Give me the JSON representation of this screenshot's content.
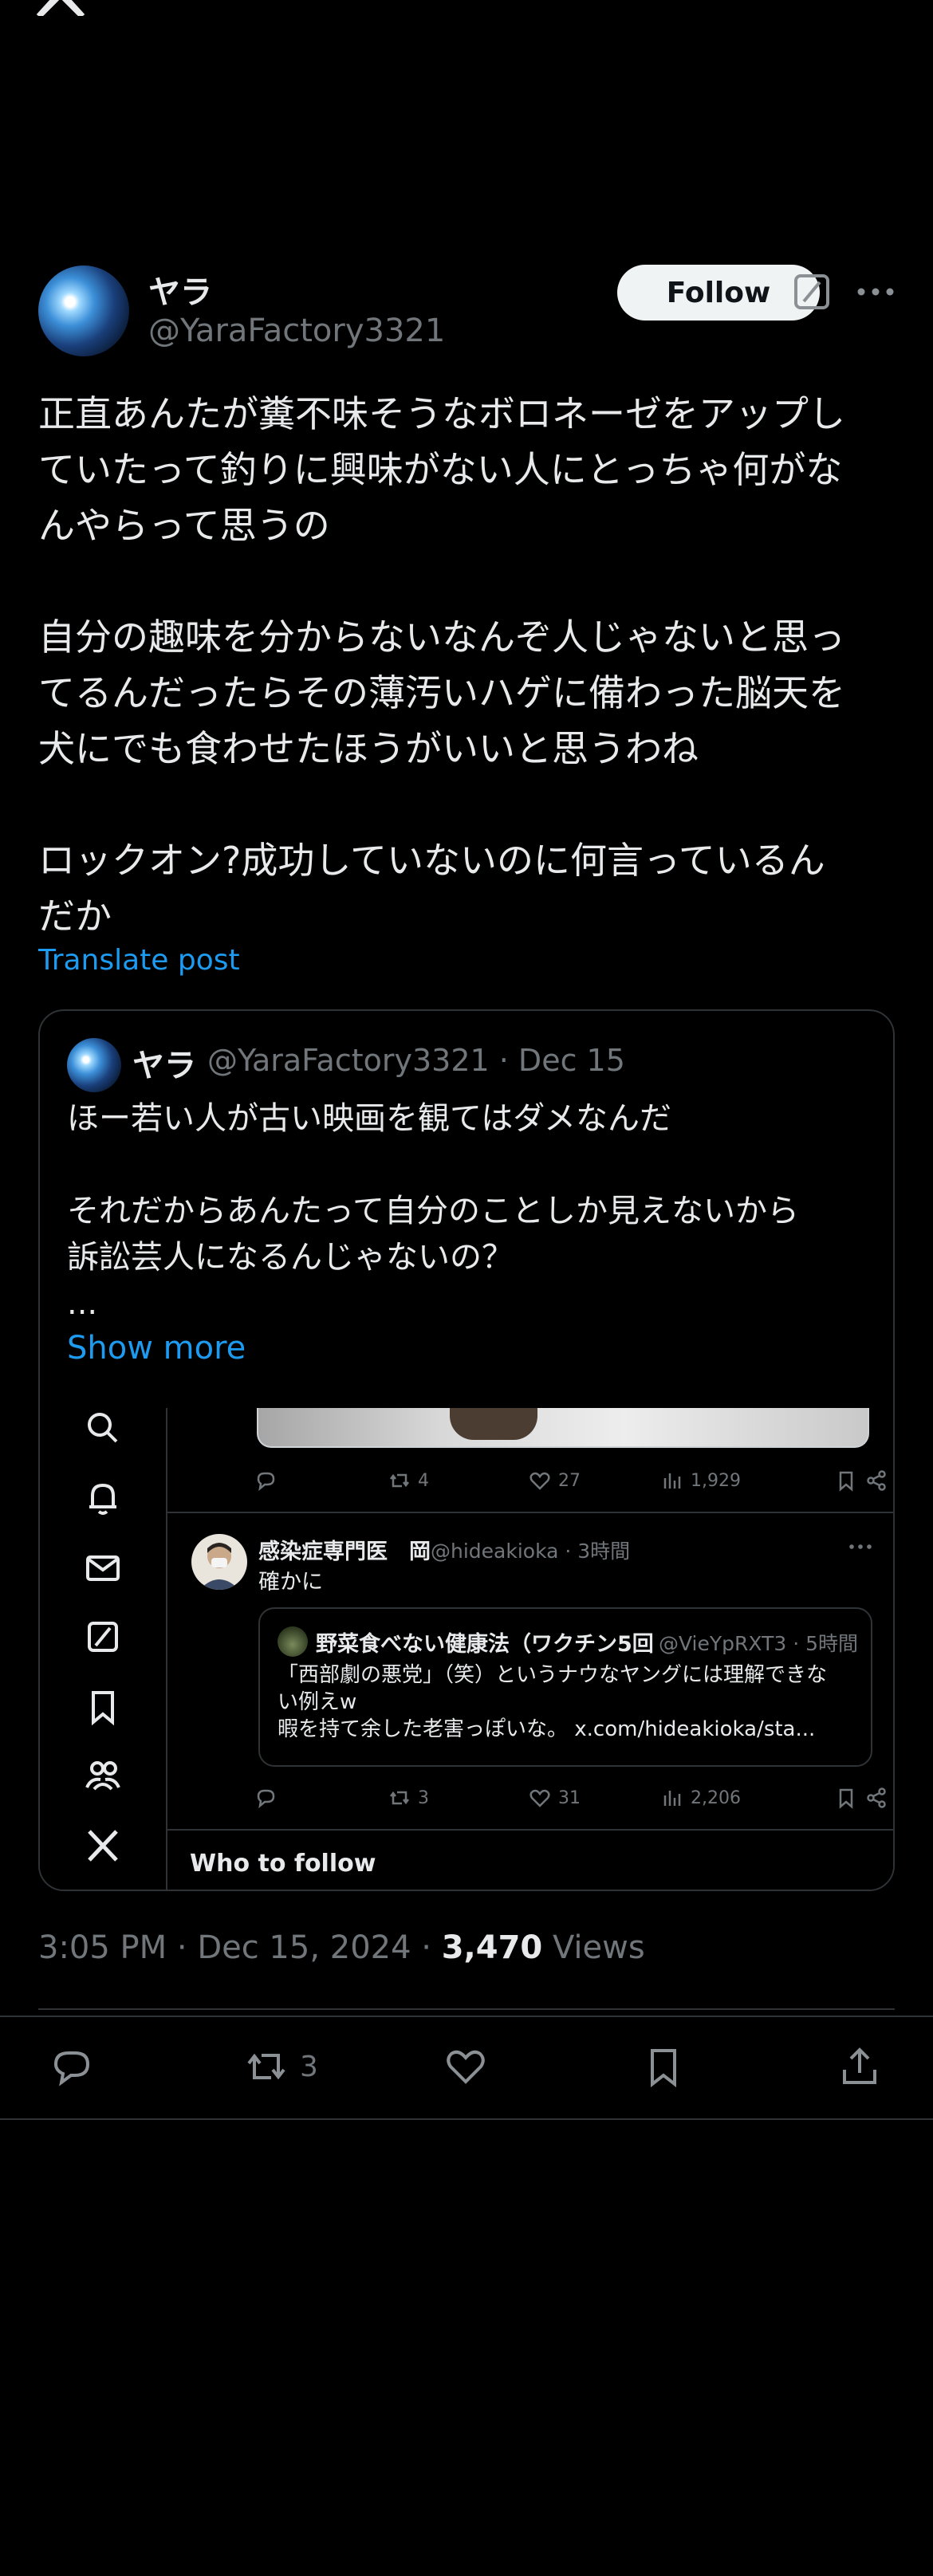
{
  "top_logo": "x-logo-icon",
  "post": {
    "author": {
      "name": "ヤラ",
      "handle": "@YaraFactory3321"
    },
    "follow_label": "Follow",
    "text": "正直あんたが糞不味そうなボロネーゼをアップし\nていたって釣りに興味がない人にとっちゃ何がな\nんやらって思うの\n\n自分の趣味を分からないなんぞ人じゃないと思っ\nてるんだったらその薄汚いハゲに備わった脳天を\n犬にでも食わせたほうがいいと思うわね\n\nロックオン?成功していないのに何言っているん\nだか",
    "translate_label": "Translate post",
    "time": "3:05 PM · Dec 15, 2024 · ",
    "views_count": "3,470",
    "views_label": " Views",
    "retweet_count": "3"
  },
  "quote": {
    "name": "ヤラ",
    "handle_date": "@YaraFactory3321 · Dec 15",
    "text": "ほー若い人が古い映画を観てはダメなんだ\n\nそれだからあんたって自分のことしか見えないから\n訴訟芸人になるんじゃないの？\n...",
    "show_more": "Show more",
    "screenshot": {
      "tweet1_stats": {
        "retweets": "4",
        "likes": "27",
        "views": "1,929"
      },
      "tweet2": {
        "name": "感染症専門医　岡",
        "handle_time": "@hideakioka · 3時間",
        "text": "確かに",
        "quoted": {
          "name": "野菜食べない健康法（ワクチン5回",
          "handle_time": "@VieYpRXT3 · 5時間",
          "text": "「西部劇の悪党」（笑）というナウなヤングには理解できな\nい例えw\n暇を持て余した老害っぽいな。 x.com/hideakioka/sta..."
        },
        "stats": {
          "retweets": "3",
          "likes": "31",
          "views": "2,206"
        }
      },
      "who_to_follow": "Who to follow"
    }
  }
}
